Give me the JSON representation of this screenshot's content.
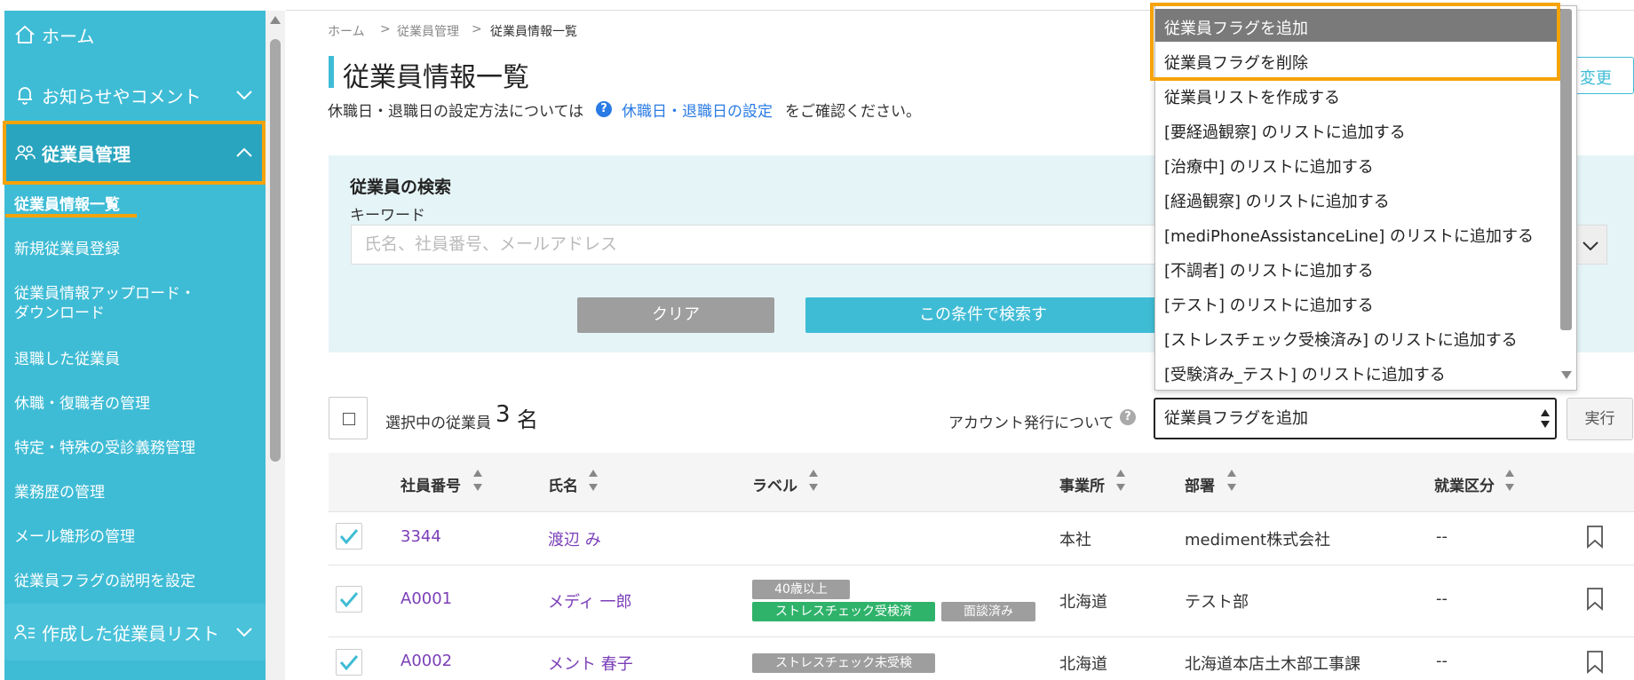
{
  "sidebar": {
    "home": "ホーム",
    "notices": "お知らせやコメント",
    "employee_mgmt": "従業員管理",
    "sub_items": [
      "従業員情報一覧",
      "新規従業員登録",
      "従業員情報アップロード・",
      "ダウンロード",
      "退職した従業員",
      "休職・復職者の管理",
      "特定・特殊の受診義務管理",
      "業務歴の管理",
      "メール雛形の管理",
      "従業員フラグの説明を設定"
    ],
    "created_lists": "作成した従業員リスト"
  },
  "breadcrumb": [
    "ホーム",
    ">",
    "従業員管理",
    ">",
    "従業員情報一覧"
  ],
  "page_title": "従業員情報一覧",
  "note": {
    "prefix": "休職日・退職日の設定方法については",
    "link": "休職日・退職日の設定",
    "suffix": "をご確認ください。"
  },
  "change_button": "変更",
  "search": {
    "heading": "従業員の検索",
    "keyword_label": "キーワード",
    "placeholder": "氏名、社員番号、メールアドレス",
    "clear": "クリア",
    "submit": "この条件で検索す"
  },
  "bulk": {
    "selected_label": "選択中の従業員",
    "selected_count": "3",
    "selected_unit": "名",
    "account_label": "アカウント発行について",
    "action_value": "従業員フラグを追加",
    "exec": "実行"
  },
  "dropdown_options": [
    "従業員フラグを追加",
    "従業員フラグを削除",
    "従業員リストを作成する",
    "[要経過観察] のリストに追加する",
    "[治療中] のリストに追加する",
    "[経過観察] のリストに追加する",
    "[mediPhoneAssistanceLine] のリストに追加する",
    "[不調者] のリストに追加する",
    "[テスト] のリストに追加する",
    "[ストレスチェック受検済み] のリストに追加する",
    "[受験済み_テスト] のリストに追加する"
  ],
  "table": {
    "headers": [
      "社員番号",
      "氏名",
      "ラベル",
      "事業所",
      "部署",
      "就業区分"
    ],
    "rows": [
      {
        "id": "3344",
        "name": "渡辺 み",
        "office": "本社",
        "dept": "mediment株式会社",
        "type": "--"
      },
      {
        "id": "A0001",
        "name": "メディ 一郎",
        "office": "北海道",
        "dept": "テスト部",
        "type": "--",
        "labels": [
          "40歳以上",
          "ストレスチェック受検済",
          "面談済み"
        ]
      },
      {
        "id": "A0002",
        "name": "メント 春子",
        "office": "北海道",
        "dept": "北海道本店土木部工事課",
        "type": "--",
        "labels": [
          "ストレスチェック未受検"
        ]
      }
    ]
  },
  "colors": {
    "sidebar": "#3fbcd5",
    "highlight": "#f5a30a",
    "tag_green": "#2fb36b",
    "tag_gray": "#9e9e9e",
    "link": "#7b3fb8"
  }
}
